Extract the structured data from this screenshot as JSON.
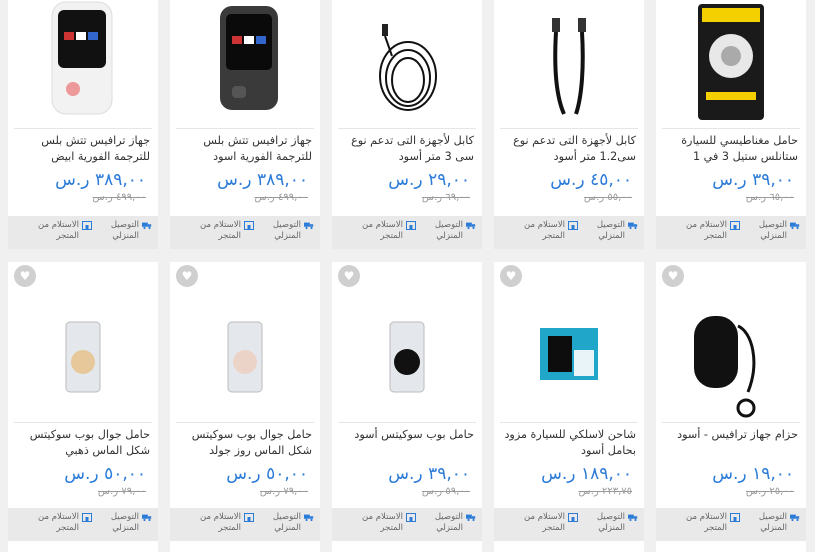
{
  "labels": {
    "delivery": "التوصيل المنزلي",
    "pickup": "الاستلام من المتجر"
  },
  "colors": {
    "price": "#2b7bd8",
    "footer_bg": "#e9e9e9",
    "page_bg": "#f0f0f0"
  },
  "products": [
    {
      "name": "جهاز ترافيس تتش بلس للترجمة الفورية ابيض",
      "price": "٣٨٩,٠٠ ر.س",
      "old_price": "٤٩٩,٠٠ ر.س",
      "image": "translator-white"
    },
    {
      "name": "جهاز ترافيس تتش بلس للترجمة الفورية اسود",
      "price": "٣٨٩,٠٠ ر.س",
      "old_price": "٤٩٩,٠٠ ر.س",
      "image": "translator-black"
    },
    {
      "name": "كابل لأجهزة التى تدعم نوع سى 3 متر أسود",
      "price": "٢٩,٠٠ ر.س",
      "old_price": "٦٩,٠٠ ر.س",
      "image": "cable-coil"
    },
    {
      "name": "كابل لأجهزة التى تدعم نوع سى1.2 متر أسود",
      "price": "٤٥,٠٠ ر.س",
      "old_price": "٥٥,٠٠ ر.س",
      "image": "cable-straight"
    },
    {
      "name": "حامل مغناطيسي للسيارة ستانلس ستيل 3 في 1",
      "price": "٣٩,٠٠ ر.س",
      "old_price": "٦٥,٠٠ ر.س",
      "image": "magnet-holder-box"
    },
    {
      "name": "حامل جوال بوب سوكيتس شكل الماس ذهبي",
      "price": "٥٠,٠٠ ر.س",
      "old_price": "٧٩,٠٠ ر.س",
      "image": "popsocket-gold"
    },
    {
      "name": "حامل جوال بوب سوكيتس شكل الماس روز جولد",
      "price": "٥٠,٠٠ ر.س",
      "old_price": "٧٩,٠٠ ر.س",
      "image": "popsocket-rose"
    },
    {
      "name": "حامل بوب سوكيتس أسود",
      "price": "٣٩,٠٠ ر.س",
      "old_price": "٥٩,٠٠ ر.س",
      "image": "popsocket-black"
    },
    {
      "name": "شاحن لاسلكي للسيارة مزود بحامل أسود",
      "price": "١٨٩,٠٠ ر.س",
      "old_price": "٢٢٣,٧٥ ر.س",
      "image": "wireless-car-charger"
    },
    {
      "name": "حزام جهاز ترافيس - أسود",
      "price": "١٩,٠٠ ر.س",
      "old_price": "٢٥,٠٠ ر.س",
      "image": "travis-strap"
    }
  ]
}
